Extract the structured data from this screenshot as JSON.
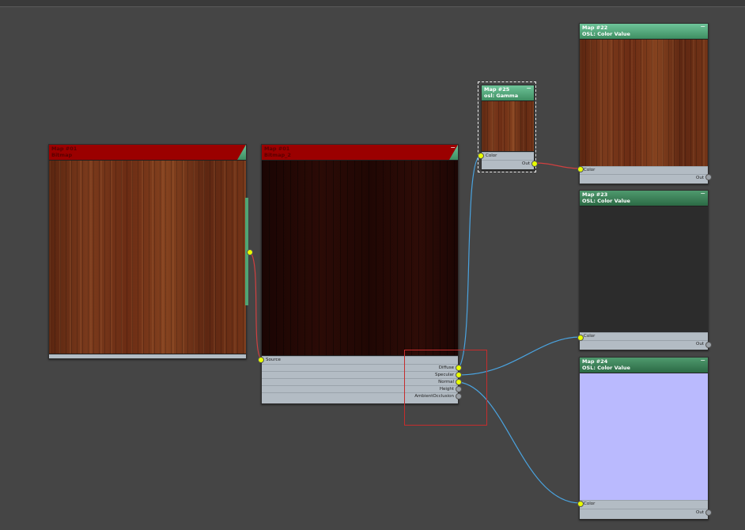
{
  "nodes": {
    "bitmap_left": {
      "title": "Map #01",
      "subtitle": "Bitmap",
      "minimize": ""
    },
    "bitmap_mid": {
      "title": "Map #01",
      "subtitle": "Bitmap_2",
      "minimize": "−",
      "ports": {
        "source": "Source",
        "diffuse": "Diffuse",
        "specular": "Specular",
        "normal": "Normal",
        "height": "Height",
        "ao": "AmbientOcclusion"
      }
    },
    "gamma": {
      "title": "Map #25",
      "subtitle": "osl: Gamma",
      "minimize": "−",
      "port_in": "Color",
      "port_out": "Out"
    },
    "map22": {
      "title": "Map #22",
      "subtitle": "OSL: Color Value",
      "minimize": "−",
      "port_in": "Color",
      "port_out": "Out"
    },
    "map23": {
      "title": "Map #23",
      "subtitle": "OSL: Color Value",
      "minimize": "−",
      "port_in": "Color",
      "port_out": "Out"
    },
    "map24": {
      "title": "Map #24",
      "subtitle": "OSL: Color Value",
      "minimize": "−",
      "port_in": "Color",
      "port_out": "Out"
    }
  },
  "colors": {
    "wire_blue": "#4aa3df",
    "wire_red": "#d04040",
    "port_active": "#e8ff00",
    "header_green": "#4f9a6e",
    "header_red": "#9b0000"
  }
}
